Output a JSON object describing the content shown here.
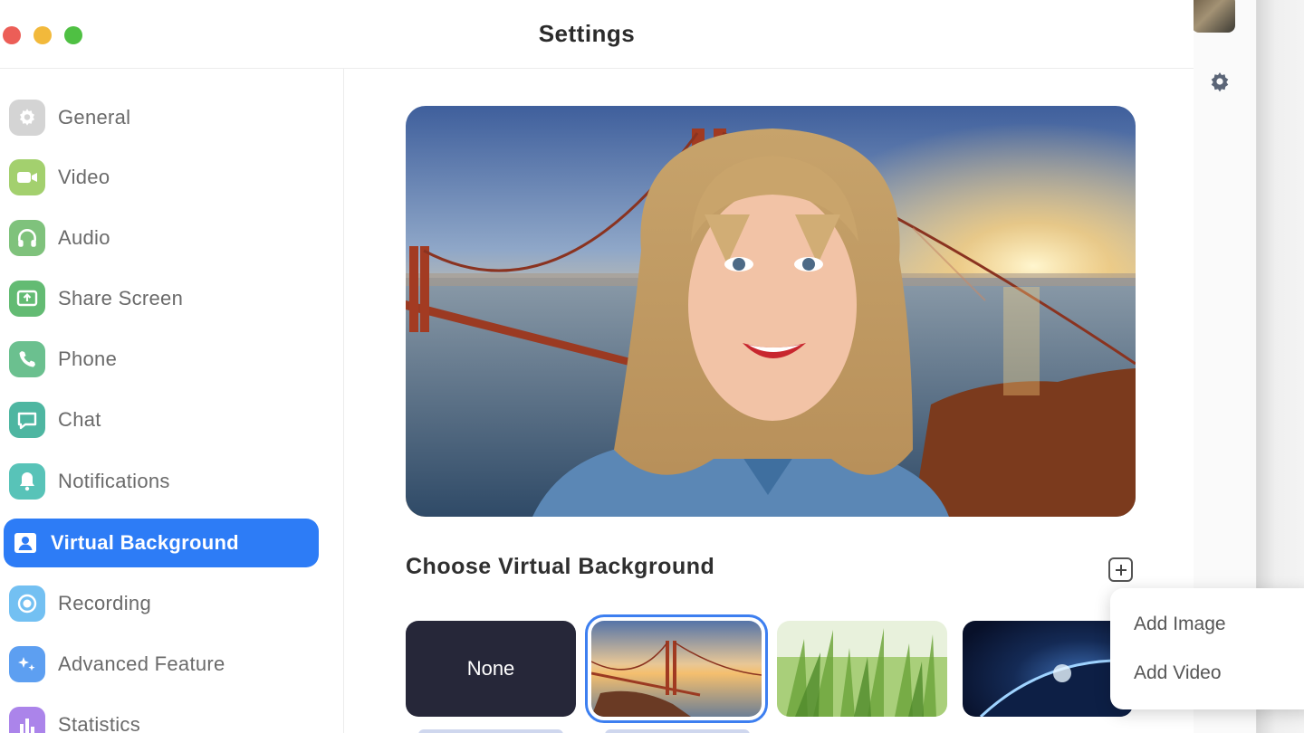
{
  "window": {
    "title": "Settings"
  },
  "sidebar": {
    "items": [
      {
        "label": "General",
        "icon": "gear-icon",
        "color": "#cfcfcf"
      },
      {
        "label": "Video",
        "icon": "video-camera-icon",
        "color": "#9ccf6a"
      },
      {
        "label": "Audio",
        "icon": "headphones-icon",
        "color": "#7cc07a"
      },
      {
        "label": "Share Screen",
        "icon": "share-screen-icon",
        "color": "#5fba72"
      },
      {
        "label": "Phone",
        "icon": "phone-icon",
        "color": "#67bf8c"
      },
      {
        "label": "Chat",
        "icon": "chat-bubble-icon",
        "color": "#4db6a0"
      },
      {
        "label": "Notifications",
        "icon": "bell-icon",
        "color": "#55c2b8"
      },
      {
        "label": "Virtual Background",
        "icon": "person-portrait-icon",
        "color": "#2d7cf6",
        "active": true
      },
      {
        "label": "Recording",
        "icon": "record-icon",
        "color": "#6cbcf0"
      },
      {
        "label": "Advanced Feature",
        "icon": "sparkles-icon",
        "color": "#5a9bf0"
      },
      {
        "label": "Statistics",
        "icon": "bar-chart-icon",
        "color": "#a77ee8"
      }
    ]
  },
  "main": {
    "section_title": "Choose Virtual Background",
    "thumbnails": [
      {
        "label": "None",
        "kind": "none"
      },
      {
        "kind": "golden-gate-bridge",
        "selected": true
      },
      {
        "kind": "grass"
      },
      {
        "kind": "earth-from-space"
      }
    ]
  },
  "add_menu": {
    "items": [
      "Add Image",
      "Add Video"
    ]
  }
}
